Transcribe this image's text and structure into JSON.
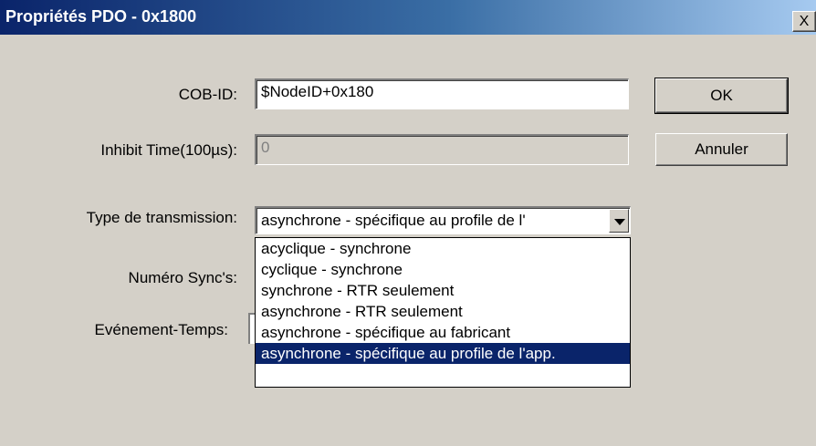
{
  "window": {
    "title": "Propriétés PDO - 0x1800",
    "close_label": "X"
  },
  "fields": {
    "cob_id": {
      "label": "COB-ID:",
      "value": "$NodeID+0x180"
    },
    "inhibit_time": {
      "label": "Inhibit Time(100µs):",
      "value": "0"
    },
    "transmission_type": {
      "label": "Type de transmission:",
      "value": "asynchrone - spécifique au profile de l'",
      "options": [
        "acyclique - synchrone",
        "cyclique - synchrone",
        "synchrone - RTR seulement",
        "asynchrone - RTR seulement",
        "asynchrone - spécifique au fabricant",
        "asynchrone - spécifique au profile de l'app."
      ],
      "selected_option": "asynchrone - spécifique au profile de l'app."
    },
    "sync_number": {
      "label": "Numéro Sync's:"
    },
    "event_time": {
      "label": "Evénement-Temps:"
    }
  },
  "buttons": {
    "ok": "OK",
    "cancel": "Annuler"
  }
}
